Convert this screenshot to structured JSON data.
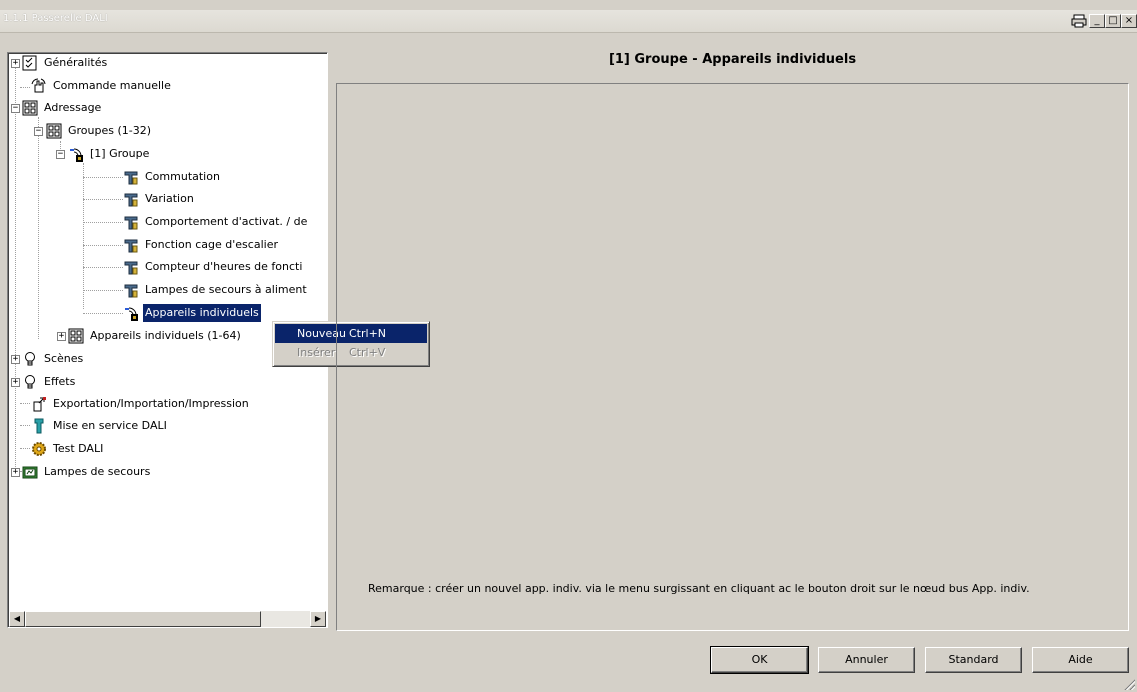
{
  "window": {
    "title": "1.1.1 Passerelle DALI",
    "controls": {
      "print": "🖶",
      "minimize": "_",
      "maximize": "□",
      "close": "×"
    }
  },
  "tree": {
    "items": [
      {
        "id": "generalites",
        "label": "Généralités",
        "icon": "checklist-icon",
        "expander": "+"
      },
      {
        "id": "commande-manuelle",
        "label": "Commande manuelle",
        "icon": "hand-icon"
      },
      {
        "id": "adressage",
        "label": "Adressage",
        "icon": "grid-icon",
        "expander": "−"
      },
      {
        "id": "groupes",
        "label": "Groupes (1-32)",
        "icon": "grid-icon",
        "expander": "−"
      },
      {
        "id": "groupe-1",
        "label": "[1] Groupe",
        "icon": "group-device-icon",
        "expander": "−"
      },
      {
        "id": "commutation",
        "label": "Commutation",
        "icon": "tool-icon"
      },
      {
        "id": "variation",
        "label": "Variation",
        "icon": "tool-icon"
      },
      {
        "id": "comportement",
        "label": "Comportement d'activat. / de",
        "icon": "tool-icon"
      },
      {
        "id": "cage-escalier",
        "label": "Fonction cage d'escalier",
        "icon": "tool-icon"
      },
      {
        "id": "compteur",
        "label": "Compteur d'heures de foncti",
        "icon": "tool-icon"
      },
      {
        "id": "lampes-secours-alim",
        "label": "Lampes de secours à aliment",
        "icon": "tool-icon"
      },
      {
        "id": "appareils-individuels",
        "label": "Appareils individuels",
        "icon": "group-device-icon",
        "selected": true
      },
      {
        "id": "appareils-individuels-64",
        "label": "Appareils individuels (1-64)",
        "icon": "grid-icon",
        "expander": "+"
      },
      {
        "id": "scenes",
        "label": "Scènes",
        "icon": "bulb-icon",
        "expander": "+"
      },
      {
        "id": "effets",
        "label": "Effets",
        "icon": "bulb-icon",
        "expander": "+"
      },
      {
        "id": "export",
        "label": "Exportation/Importation/Impression",
        "icon": "export-icon"
      },
      {
        "id": "mise-en-service",
        "label": "Mise en service DALI",
        "icon": "wrench-icon"
      },
      {
        "id": "test-dali",
        "label": "Test DALI",
        "icon": "gear-icon"
      },
      {
        "id": "lampes-secours",
        "label": "Lampes de secours",
        "icon": "emergency-lamp-icon",
        "expander": "+"
      }
    ]
  },
  "context_menu": {
    "items": [
      {
        "label": "Nouveau",
        "shortcut": "Ctrl+N",
        "enabled": true
      },
      {
        "label": "Insérer",
        "shortcut": "Ctrl+V",
        "enabled": false
      }
    ]
  },
  "main": {
    "title": "[1] Groupe - Appareils individuels",
    "remark": "Remarque : créer un nouvel app. indiv. via le menu surgissant en cliquant ac le  bouton droit sur le nœud bus App. indiv."
  },
  "buttons": {
    "ok": "OK",
    "cancel": "Annuler",
    "standard": "Standard",
    "help": "Aide"
  },
  "scrollbar": {
    "left_arrow": "◀",
    "right_arrow": "▶"
  }
}
